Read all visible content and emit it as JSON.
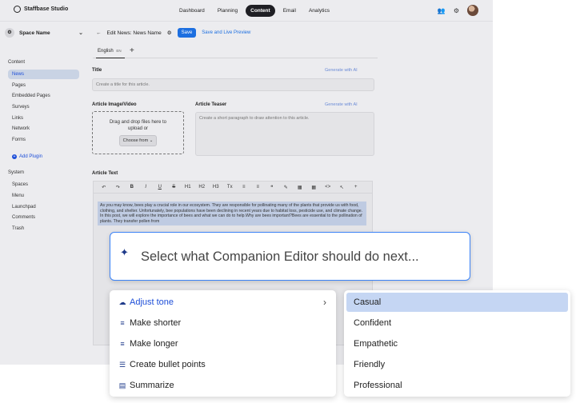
{
  "app": {
    "logo": "Staffbase Studio",
    "nav": [
      "Dashboard",
      "Planning",
      "Content",
      "Email",
      "Analytics"
    ],
    "nav_active": "Content"
  },
  "sidebar": {
    "space": "Space Name",
    "content_heading": "Content",
    "content_items": [
      "News",
      "Pages",
      "Embedded Pages",
      "Surveys",
      "Links",
      "Network",
      "Forms"
    ],
    "add_plugin": "Add Plugin",
    "system_heading": "System",
    "system_items": [
      "Spaces",
      "Menu",
      "Launchpad",
      "Comments",
      "Trash"
    ]
  },
  "editor": {
    "title": "Edit News: News Name",
    "save": "Save",
    "save_live": "Save and Live Preview",
    "lang_tab": "English",
    "lang_code": "EN",
    "title_label": "Title",
    "title_placeholder": "Create a title for this article.",
    "generate_ai": "Generate with AI",
    "image_label": "Article Image/Video",
    "drop_text_1": "Drag and drop files here to",
    "drop_text_2": "upload or",
    "choose_from": "Choose from",
    "teaser_label": "Article Teaser",
    "teaser_placeholder": "Create a short paragraph to draw attention to this article.",
    "text_label": "Article Text",
    "toolbar": [
      "↶",
      "↷",
      "B",
      "I",
      "U",
      "S",
      "H1",
      "H2",
      "H3",
      "Tx",
      "≡",
      "≡",
      "❝",
      "✎",
      "▦",
      "▦",
      "<>",
      "↖",
      "+"
    ],
    "article_text": "As you may know, bees play a crucial role in our ecosystem. They are responsible for pollinating many of the plants that provide us with food, clothing, and shelter. Unfortunately, bee populations have been declining in recent years due to habitat loss, pesticide use, and climate change. In this post, we will explore the importance of bees and what we can do to help.Why are bees important?Bees are essential to the pollination of plants. They transfer pollen from"
  },
  "prompt": {
    "text": "Select what Companion Editor should do next..."
  },
  "menu": {
    "items": [
      {
        "label": "Adjust tone",
        "icon": "cloud-icon"
      },
      {
        "label": "Make shorter",
        "icon": "lines-short-icon"
      },
      {
        "label": "Make longer",
        "icon": "lines-long-icon"
      },
      {
        "label": "Create bullet points",
        "icon": "bullets-icon"
      },
      {
        "label": "Summarize",
        "icon": "summary-icon"
      }
    ]
  },
  "submenu": {
    "items": [
      "Casual",
      "Confident",
      "Empathetic",
      "Friendly",
      "Professional"
    ]
  },
  "colors": {
    "accent": "#1d6fe0",
    "selection": "#c5d6f3"
  }
}
